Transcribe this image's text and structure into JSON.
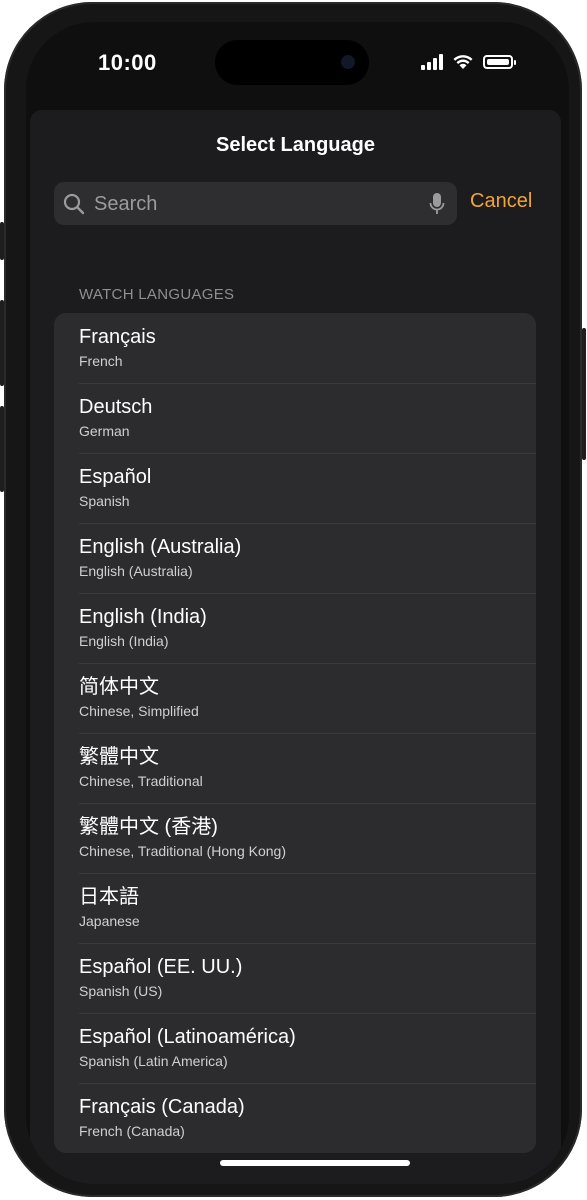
{
  "status": {
    "time": "10:00"
  },
  "sheet": {
    "title": "Select Language",
    "cancel_label": "Cancel"
  },
  "search": {
    "placeholder": "Search",
    "value": ""
  },
  "section": {
    "header": "WATCH LANGUAGES"
  },
  "languages": [
    {
      "name": "Français",
      "sub": "French"
    },
    {
      "name": "Deutsch",
      "sub": "German"
    },
    {
      "name": "Español",
      "sub": "Spanish"
    },
    {
      "name": "English (Australia)",
      "sub": "English (Australia)"
    },
    {
      "name": "English (India)",
      "sub": "English (India)"
    },
    {
      "name": "简体中文",
      "sub": "Chinese, Simplified"
    },
    {
      "name": "繁體中文",
      "sub": "Chinese, Traditional"
    },
    {
      "name": "繁體中文 (香港)",
      "sub": "Chinese, Traditional (Hong Kong)"
    },
    {
      "name": "日本語",
      "sub": "Japanese"
    },
    {
      "name": "Español (EE. UU.)",
      "sub": "Spanish (US)"
    },
    {
      "name": "Español (Latinoamérica)",
      "sub": "Spanish (Latin America)"
    },
    {
      "name": "Français (Canada)",
      "sub": "French (Canada)"
    }
  ],
  "colors": {
    "accent": "#f2a33a",
    "sheet_bg": "#1c1c1e",
    "cell_bg": "#2c2c2e",
    "search_bg": "#2e2e30"
  },
  "icons": {
    "search": "magnifying-glass-icon",
    "mic": "microphone-icon"
  }
}
